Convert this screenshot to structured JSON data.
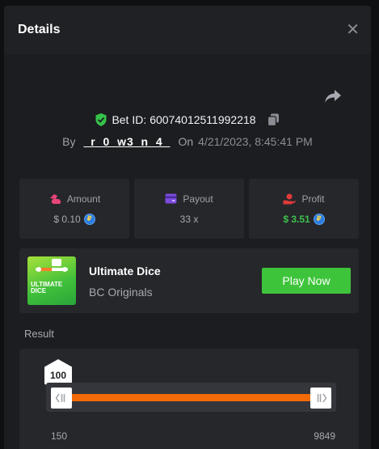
{
  "header": {
    "title": "Details"
  },
  "bet": {
    "label": "Bet ID:",
    "id": "60074012511992218",
    "by_label": "By",
    "username": "_r_0_w3_n_4_",
    "on_label": "On",
    "timestamp": "4/21/2023, 8:45:41 PM"
  },
  "stats": [
    {
      "label": "Amount",
      "value": "$ 0.10",
      "icon": "money-bag-icon",
      "color": "#e8457a"
    },
    {
      "label": "Payout",
      "value": "33 x",
      "icon": "wallet-icon",
      "color": "#7b4bdb"
    },
    {
      "label": "Profit",
      "value": "$ 3.51",
      "icon": "hand-coin-icon",
      "color": "#e03a3a"
    }
  ],
  "game": {
    "name": "Ultimate Dice",
    "provider": "BC Originals",
    "thumb_text": "ULTIMATE DICE",
    "play_label": "Play Now"
  },
  "result": {
    "label": "Result",
    "value": "100",
    "range_min": "150",
    "range_max": "9849"
  },
  "colors": {
    "accent_green": "#3ec43b",
    "range_orange": "#f26b07",
    "panel": "#1c1d20",
    "card": "#26272b"
  }
}
